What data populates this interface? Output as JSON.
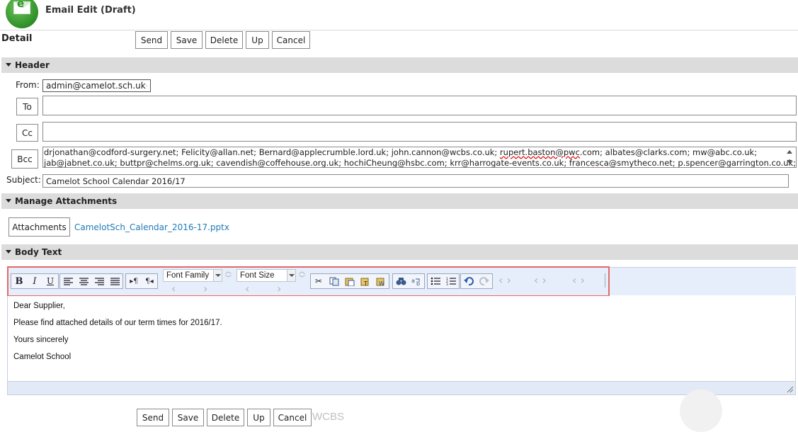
{
  "window": {
    "title": "Email Edit (Draft)"
  },
  "detail_label": "Detail",
  "toolbar": {
    "send": "Send",
    "save": "Save",
    "delete": "Delete",
    "up": "Up",
    "cancel": "Cancel"
  },
  "sections": {
    "header": "Header",
    "attachments": "Manage Attachments",
    "body": "Body Text"
  },
  "header": {
    "from_label": "From:",
    "from_value": "admin@camelot.sch.uk",
    "to_button": "To",
    "cc_button": "Cc",
    "bcc_button": "Bcc",
    "to_value": "",
    "cc_value": "",
    "bcc_line1_a": "drjonathan@codford-surgery.net; Felicity@allan.net; Bernard@applecrumble.lord.uk; john.cannon@wcbs.co.uk; ",
    "bcc_line1_sp": "rupert.baston@pwc",
    "bcc_line1_b": ".com; albates@clarks.com; mw@abc.co.uk;",
    "bcc_line2_a": "jab@jabnet.co.uk; buttpr@chelms.org.uk; cavendish@coffehouse.org.uk; hochiCheung@hsbc.com; krr@harrogate-events.co.uk; ",
    "bcc_line2_sp": "francesca",
    "bcc_line2_b": "@smytheco.net; p.spencer@garrington.co.uk;",
    "subject_label": "Subject:",
    "subject_value": "Camelot School Calendar 2016/17"
  },
  "attachments": {
    "button": "Attachments",
    "file": "CamelotSch_Calendar_2016-17.pptx"
  },
  "editor": {
    "font_family": "Font Family",
    "font_size": "Font Size",
    "lines": [
      "Dear Supplier,",
      "Please find attached details of our term times for 2016/17.",
      "Yours sincerely",
      "Camelot School"
    ]
  },
  "watermark": "WCBS",
  "icons": [
    "envelope-logo-icon",
    "collapse-triangle-icon",
    "bold-icon",
    "italic-icon",
    "underline-icon",
    "align-left-icon",
    "align-center-icon",
    "align-right-icon",
    "justify-icon",
    "ltr-icon",
    "rtl-icon",
    "cut-icon",
    "copy-icon",
    "paste-icon",
    "paste-text-icon",
    "paste-word-icon",
    "find-icon",
    "replace-icon",
    "bullet-list-icon",
    "numbered-list-icon",
    "undo-icon",
    "redo-icon",
    "resize-grip-icon"
  ]
}
